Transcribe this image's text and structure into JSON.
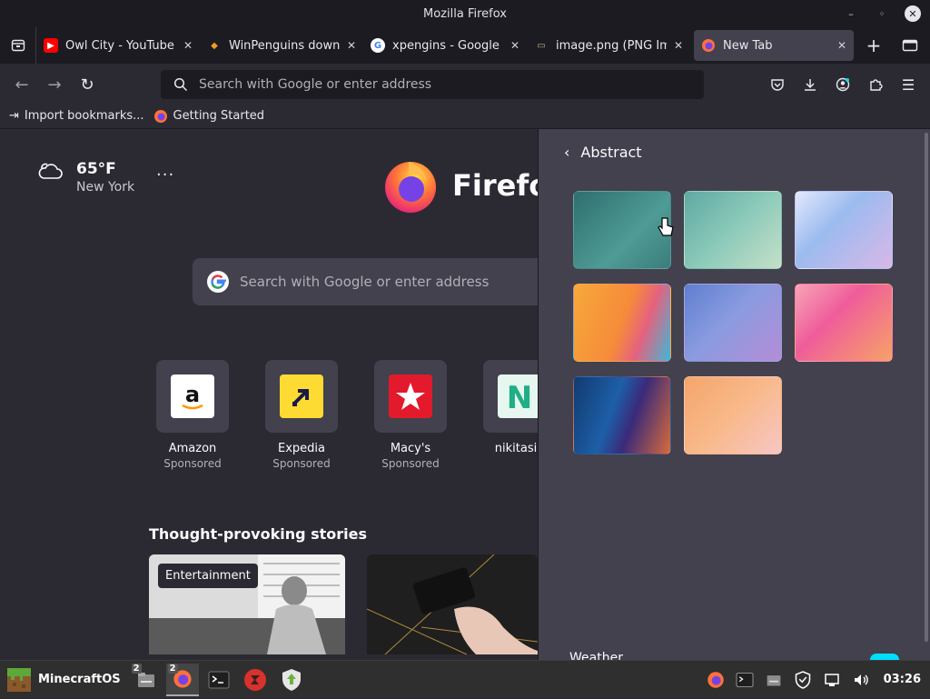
{
  "window": {
    "title": "Mozilla Firefox"
  },
  "tabs": [
    {
      "title": "Owl City - YouTube",
      "icon": "youtube-icon"
    },
    {
      "title": "WinPenguins download",
      "icon": "winpenguins-icon"
    },
    {
      "title": "xpengins - Google Search",
      "icon": "google-icon"
    },
    {
      "title": "image.png (PNG Image",
      "icon": "image-icon"
    },
    {
      "title": "New Tab",
      "icon": "firefox-icon",
      "active": true
    }
  ],
  "urlbar": {
    "placeholder": "Search with Google or enter address"
  },
  "bookmarks": [
    {
      "label": "Import bookmarks...",
      "icon": "import-icon"
    },
    {
      "label": "Getting Started",
      "icon": "firefox-icon"
    }
  ],
  "weather": {
    "temp": "65°F",
    "city": "New York"
  },
  "logo": {
    "wordmark": "Firefox"
  },
  "search": {
    "placeholder": "Search with Google or enter address"
  },
  "shortcuts": [
    {
      "name": "Amazon",
      "sponsored": "Sponsored"
    },
    {
      "name": "Expedia",
      "sponsored": "Sponsored"
    },
    {
      "name": "Macy's",
      "sponsored": "Sponsored"
    },
    {
      "name": "nikitasio"
    }
  ],
  "stories": {
    "title": "Thought-provoking stories",
    "items": [
      {
        "badge": "Entertainment"
      },
      {
        "badge": ""
      }
    ]
  },
  "wallpaper_panel": {
    "header": "Abstract",
    "footer": "Weather",
    "swatches": [
      {
        "name": "abstract-teal",
        "colors": [
          "#2e6f6f",
          "#4f9b95"
        ]
      },
      {
        "name": "abstract-mint",
        "colors": [
          "#5fa9a4",
          "#c5e0c8"
        ]
      },
      {
        "name": "abstract-lavender",
        "colors": [
          "#c9d6f6",
          "#d9b8e8"
        ]
      },
      {
        "name": "abstract-orange-pink",
        "colors": [
          "#f6a93a",
          "#e5627f"
        ]
      },
      {
        "name": "abstract-blue-purple",
        "colors": [
          "#6f8fd6",
          "#b48dd6"
        ]
      },
      {
        "name": "abstract-pink-orange",
        "colors": [
          "#ef5d9a",
          "#f7a268"
        ]
      },
      {
        "name": "abstract-dark-blue-orange",
        "colors": [
          "#123a6f",
          "#d76b3b"
        ]
      },
      {
        "name": "abstract-peach",
        "colors": [
          "#f5a56a",
          "#f7c6c6"
        ]
      }
    ]
  },
  "taskbar": {
    "start_label": "MinecraftOS",
    "files_count": "2",
    "firefox_count": "2",
    "clock": "03:26"
  },
  "colors": {
    "accent": "#00ddff",
    "chrome_dark": "#1c1b22",
    "surface": "#2b2a33",
    "tile": "#42414d"
  }
}
